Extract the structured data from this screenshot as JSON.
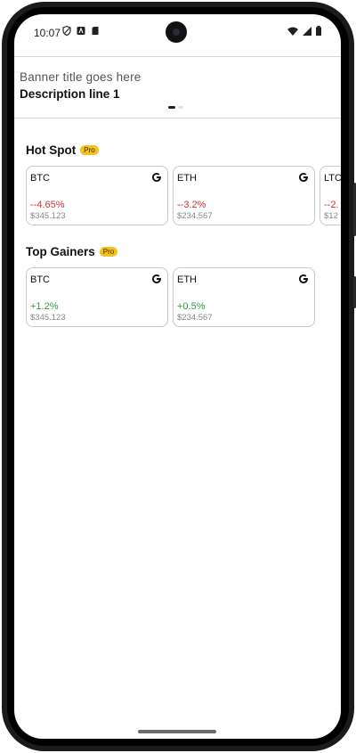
{
  "status_bar": {
    "time": "10:07",
    "left_icons": [
      "vpn-shield-icon",
      "accessibility-icon",
      "sim-card-icon"
    ],
    "right_icons": [
      "wifi-icon",
      "cellular-signal-icon",
      "battery-icon"
    ]
  },
  "banner": {
    "title": "Banner title goes here",
    "description": "Description line 1",
    "page_count": 2,
    "active_page": 1
  },
  "sections": [
    {
      "title": "Hot Spot",
      "badge": "Pro",
      "cards": [
        {
          "symbol": "BTC",
          "change": "--4.65%",
          "price": "$345.123",
          "trend": "negative"
        },
        {
          "symbol": "ETH",
          "change": "--3.2%",
          "price": "$234.567",
          "trend": "negative"
        },
        {
          "symbol": "LTC",
          "change": "--2.",
          "price": "$12",
          "trend": "negative"
        }
      ]
    },
    {
      "title": "Top Gainers",
      "badge": "Pro",
      "cards": [
        {
          "symbol": "BTC",
          "change": "+1.2%",
          "price": "$345.123",
          "trend": "positive"
        },
        {
          "symbol": "ETH",
          "change": "+0.5%",
          "price": "$234.567",
          "trend": "positive"
        }
      ]
    }
  ],
  "colors": {
    "negative": "#d32f2f",
    "positive": "#2e9e3a",
    "pro_badge": "#f2c21d"
  }
}
